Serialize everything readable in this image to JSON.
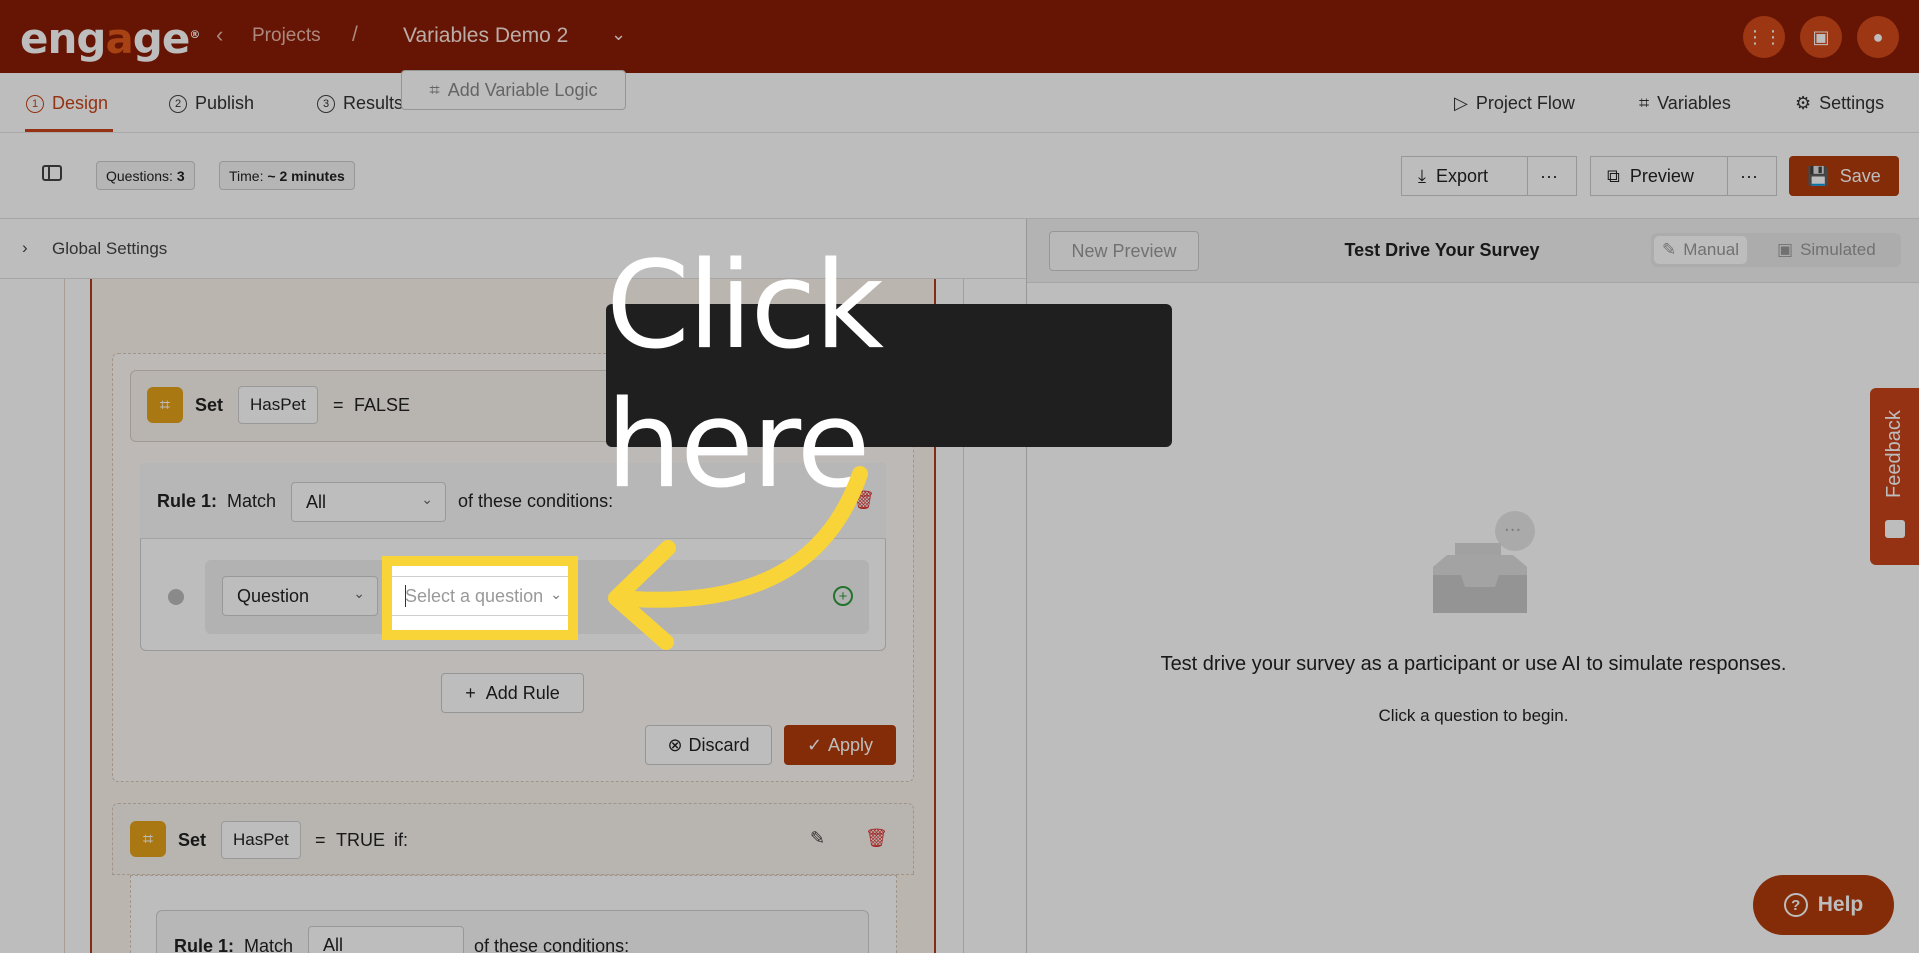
{
  "topbar": {
    "logo": "engage",
    "breadcrumb_projects": "Projects",
    "breadcrumb_sep": "/",
    "project_name": "Variables Demo 2"
  },
  "tabs": [
    {
      "num": "1",
      "label": "Design"
    },
    {
      "num": "2",
      "label": "Publish"
    },
    {
      "num": "3",
      "label": "Results"
    }
  ],
  "right_tabs": {
    "project_flow": "Project Flow",
    "variables": "Variables",
    "settings": "Settings"
  },
  "toolbar": {
    "questions_label": "Questions:",
    "questions_value": "3",
    "time_label": "Time:",
    "time_value": "~ 2 minutes",
    "export": "Export",
    "preview": "Preview",
    "save": "Save",
    "more": "···"
  },
  "left": {
    "global_settings": "Global Settings",
    "add_variable_logic": "Add Variable Logic",
    "rule_set_1": {
      "set": "Set",
      "variable": "HasPet",
      "equals": "=",
      "value": "FALSE"
    },
    "rule1": {
      "title": "Rule 1:",
      "match": "Match",
      "match_value": "All",
      "suffix": "of these conditions:",
      "condition_type": "Question",
      "question_placeholder": "Select a question"
    },
    "add_rule": "Add Rule",
    "discard": "Discard",
    "apply": "Apply",
    "rule_set_2": {
      "set": "Set",
      "variable": "HasPet",
      "equals": "=",
      "value": "TRUE",
      "if": "if:"
    },
    "rule2": {
      "title": "Rule 1:",
      "match": "Match",
      "match_value": "All",
      "suffix": "of these conditions:"
    }
  },
  "right": {
    "new_preview": "New Preview",
    "title": "Test Drive Your Survey",
    "manual": "Manual",
    "simulated": "Simulated",
    "empty_message": "Test drive your survey as a participant or use AI to simulate responses.",
    "empty_sub": "Click a question to begin."
  },
  "feedback": "Feedback",
  "help": "Help",
  "callout": "Click here",
  "colors": {
    "brand": "#8a1c05",
    "accent": "#b23a0c",
    "highlight": "#f9d438"
  }
}
